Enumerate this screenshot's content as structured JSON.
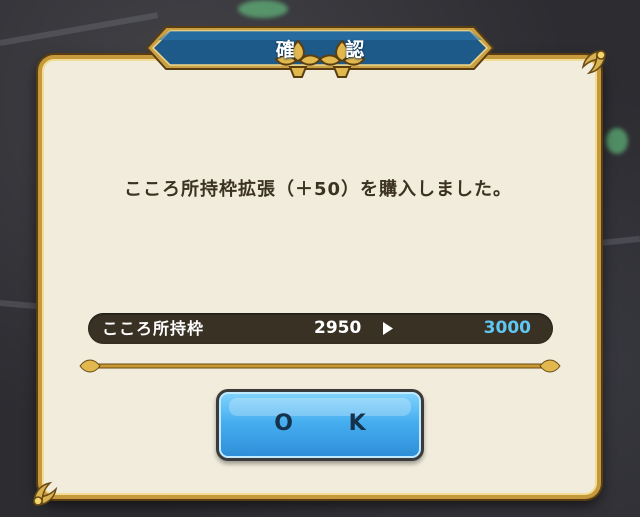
{
  "dialog": {
    "title": "確 認",
    "message": "こころ所持枠拡張（＋50）を購入しました。",
    "capacity": {
      "label": "こころ所持枠",
      "old_value": "2950",
      "new_value": "3000"
    },
    "ok_button": {
      "label": "O K"
    }
  },
  "colors": {
    "title_plate": "#1d5a8a",
    "dialog_bg": "#f1ecdc",
    "gold_trim": "#c69a3c",
    "new_value_text": "#5fc8f2",
    "ok_button": "#46aef0"
  }
}
